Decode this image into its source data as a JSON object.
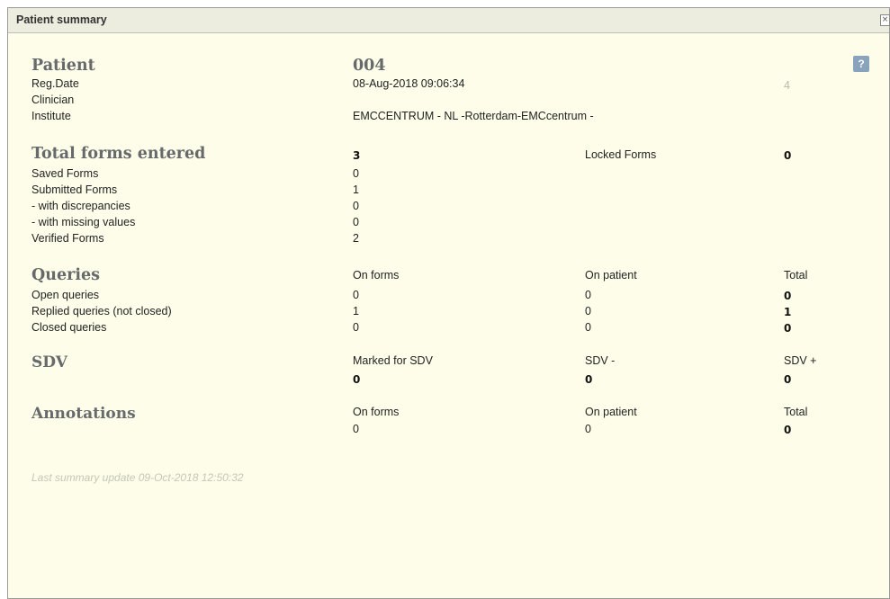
{
  "dialog": {
    "title": "Patient summary",
    "close_label": "×",
    "help_label": "?"
  },
  "patient": {
    "heading": "Patient",
    "id": "004",
    "reg_date_label": "Reg.Date",
    "reg_date_value": "08-Aug-2018 09:06:34",
    "reg_date_extra": "4",
    "clinician_label": "Clinician",
    "institute_label": "Institute",
    "institute_value": "EMCCENTRUM - NL -Rotterdam-EMCcentrum -"
  },
  "forms": {
    "heading": "Total forms entered",
    "total": "3",
    "locked_label": "Locked Forms",
    "locked_value": "0",
    "rows": [
      {
        "label": "Saved Forms",
        "value": "0"
      },
      {
        "label": "Submitted Forms",
        "value": "1"
      },
      {
        "label": "- with discrepancies",
        "value": "0"
      },
      {
        "label": "- with missing values",
        "value": "0"
      },
      {
        "label": "Verified Forms",
        "value": "2"
      }
    ]
  },
  "queries": {
    "heading": "Queries",
    "col_forms": "On forms",
    "col_patient": "On patient",
    "col_total": "Total",
    "rows": [
      {
        "label": "Open queries",
        "forms": "0",
        "patient": "0",
        "total": "0"
      },
      {
        "label": "Replied queries (not closed)",
        "forms": "1",
        "patient": "0",
        "total": "1"
      },
      {
        "label": "Closed queries",
        "forms": "0",
        "patient": "0",
        "total": "0"
      }
    ]
  },
  "sdv": {
    "heading": "SDV",
    "col_marked": "Marked for SDV",
    "col_minus": "SDV -",
    "col_plus": "SDV +",
    "marked": "0",
    "minus": "0",
    "plus": "0"
  },
  "annotations": {
    "heading": "Annotations",
    "col_forms": "On forms",
    "col_patient": "On patient",
    "col_total": "Total",
    "forms": "0",
    "patient": "0",
    "total": "0"
  },
  "footer": {
    "last_update": "Last summary update 09-Oct-2018 12:50:32"
  }
}
